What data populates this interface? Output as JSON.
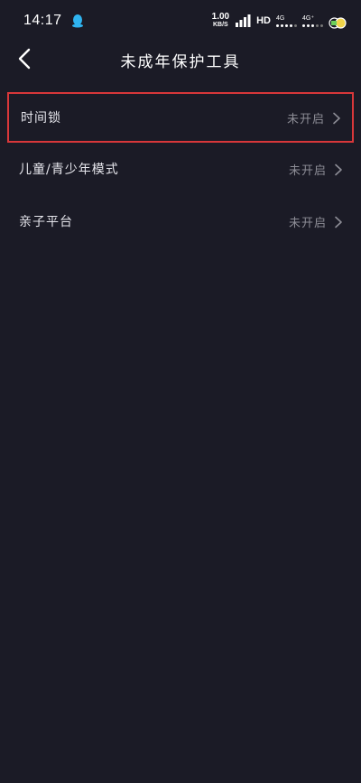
{
  "status_bar": {
    "time": "14:17",
    "net_speed_value": "1.00",
    "net_speed_unit": "KB/S",
    "hd_label": "HD",
    "sim1_label": "4G",
    "sim2_label": "4G⁺",
    "icons": [
      "qq-icon",
      "wifi-icon",
      "signal-icon",
      "battery-icon"
    ]
  },
  "nav": {
    "title": "未成年保护工具",
    "back_icon": "chevron-left-icon"
  },
  "settings": {
    "items": [
      {
        "label": "时间锁",
        "value": "未开启",
        "highlighted": true
      },
      {
        "label": "儿童/青少年模式",
        "value": "未开启",
        "highlighted": false
      },
      {
        "label": "亲子平台",
        "value": "未开启",
        "highlighted": false
      }
    ]
  },
  "colors": {
    "background": "#1b1b26",
    "highlight_border": "#d8373a",
    "secondary_text": "#8d8d96"
  }
}
